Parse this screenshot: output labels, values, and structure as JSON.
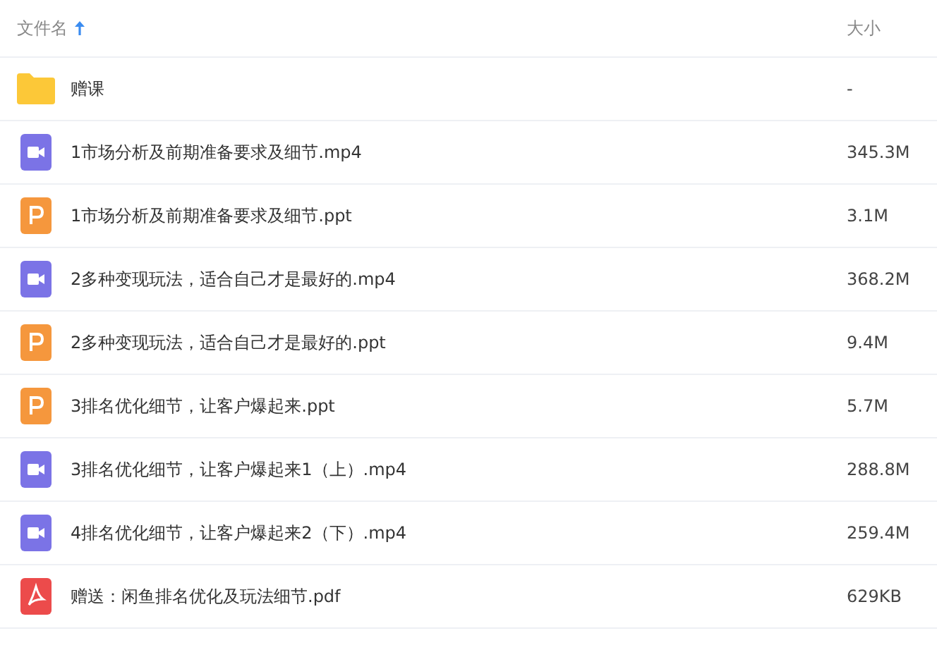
{
  "header": {
    "name": "文件名",
    "sort_ascending": true,
    "size": "大小"
  },
  "files": [
    {
      "kind": "folder",
      "name": "赠课",
      "size": "-"
    },
    {
      "kind": "video",
      "name": "1市场分析及前期准备要求及细节.mp4",
      "size": "345.3M"
    },
    {
      "kind": "ppt",
      "name": "1市场分析及前期准备要求及细节.ppt",
      "size": "3.1M"
    },
    {
      "kind": "video",
      "name": "2多种变现玩法，适合自己才是最好的.mp4",
      "size": "368.2M"
    },
    {
      "kind": "ppt",
      "name": "2多种变现玩法，适合自己才是最好的.ppt",
      "size": "9.4M"
    },
    {
      "kind": "ppt",
      "name": "3排名优化细节，让客户爆起来.ppt",
      "size": "5.7M"
    },
    {
      "kind": "video",
      "name": "3排名优化细节，让客户爆起来1（上）.mp4",
      "size": "288.8M"
    },
    {
      "kind": "video",
      "name": "4排名优化细节，让客户爆起来2（下）.mp4",
      "size": "259.4M"
    },
    {
      "kind": "pdf",
      "name": "赠送：闲鱼排名优化及玩法细节.pdf",
      "size": "629KB"
    }
  ]
}
